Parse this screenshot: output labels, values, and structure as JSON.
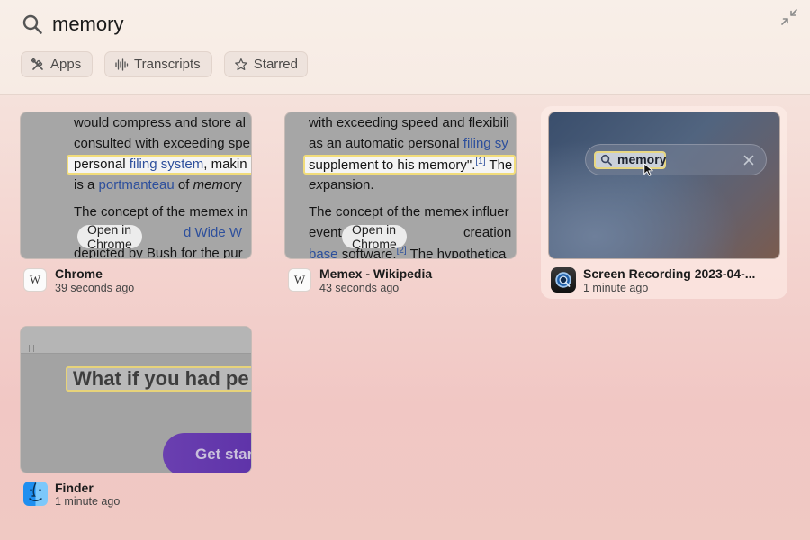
{
  "search": {
    "query": "memory"
  },
  "filters": [
    {
      "label": "Apps",
      "icon": "tools-icon"
    },
    {
      "label": "Transcripts",
      "icon": "waveform-icon"
    },
    {
      "label": "Starred",
      "icon": "star-icon"
    }
  ],
  "results": [
    {
      "app": "Chrome",
      "time": "39 seconds ago",
      "app_icon": "wikipedia-icon",
      "app_icon_text": "W",
      "overlay_button": "Open in Chrome",
      "snippet": {
        "l1": "would compress and store al",
        "l2": "consulted with exceeding spe",
        "l3a": "personal ",
        "l3b": "filing system",
        "l3c": ", makin",
        "l4a": "is a ",
        "l4b": "portmanteau",
        "l4c": " of ",
        "l4d": "mem",
        "l4e": "ory",
        "l5": "The concept of the memex in",
        "l6": "d Wide W",
        "l7": "depicted by Bush for the pur"
      }
    },
    {
      "app": "Memex - Wikipedia",
      "time": "43 seconds ago",
      "app_icon": "wikipedia-icon",
      "app_icon_text": "W",
      "overlay_button": "Open in Chrome",
      "snippet": {
        "l1": "with exceeding speed and flexibili",
        "l2a": "as an automatic personal ",
        "l2b": "filing sy",
        "l3a": "supplement to his memory\".",
        "l3b": "[1]",
        "l3c": " The",
        "l4a": "ex",
        "l4b": "pansion.",
        "l5": "The concept of the memex influer",
        "l6a": "event",
        "l6b": "creation",
        "l7a": "base",
        "l7b": " software.",
        "l7c": "[2]",
        "l7d": " The hypothetica"
      }
    },
    {
      "app": "Screen Recording 2023-04-...",
      "time": "1 minute ago",
      "app_icon": "quicktime-icon",
      "thumb_search": "memory"
    },
    {
      "app": "Finder",
      "time": "1 minute ago",
      "app_icon": "finder-icon",
      "thumb_heading": "What if you had pe",
      "thumb_button": "Get star"
    }
  ]
}
